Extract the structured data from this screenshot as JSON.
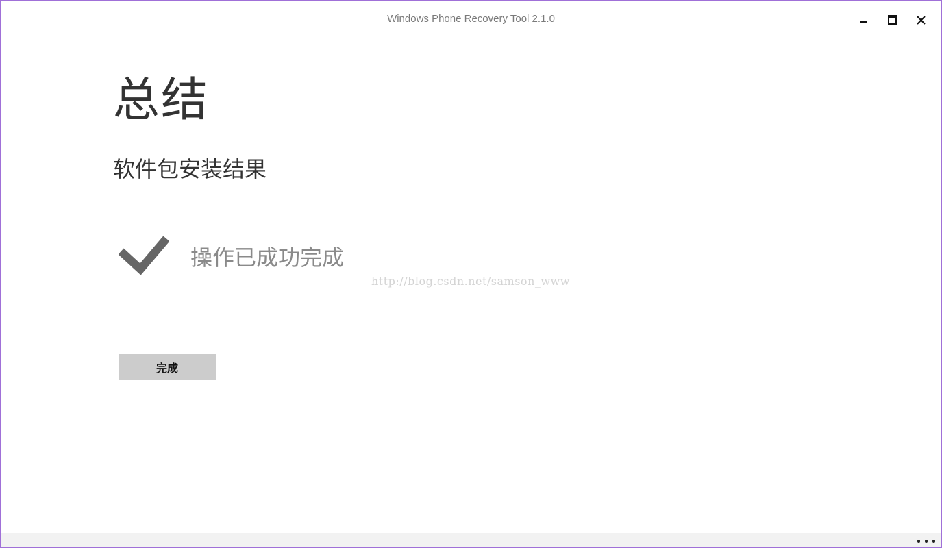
{
  "window": {
    "title": "Windows Phone Recovery Tool 2.1.0",
    "controls": {
      "minimize_icon": "minimize-icon",
      "maximize_icon": "maximize-icon",
      "close_icon": "close-icon",
      "close_glyph": "✕"
    }
  },
  "page": {
    "title": "总结",
    "subtitle": "软件包安装结果",
    "status_icon": "checkmark-icon",
    "status_text": "操作已成功完成",
    "watermark": "http://blog.csdn.net/samson_www",
    "done_label": "完成"
  },
  "app_bar": {
    "more_icon": "more-options-icon"
  },
  "colors": {
    "window_border": "#a070d8",
    "button_bg": "#cccccc",
    "app_bar_bg": "#f2f2f2",
    "check": "#666666"
  }
}
